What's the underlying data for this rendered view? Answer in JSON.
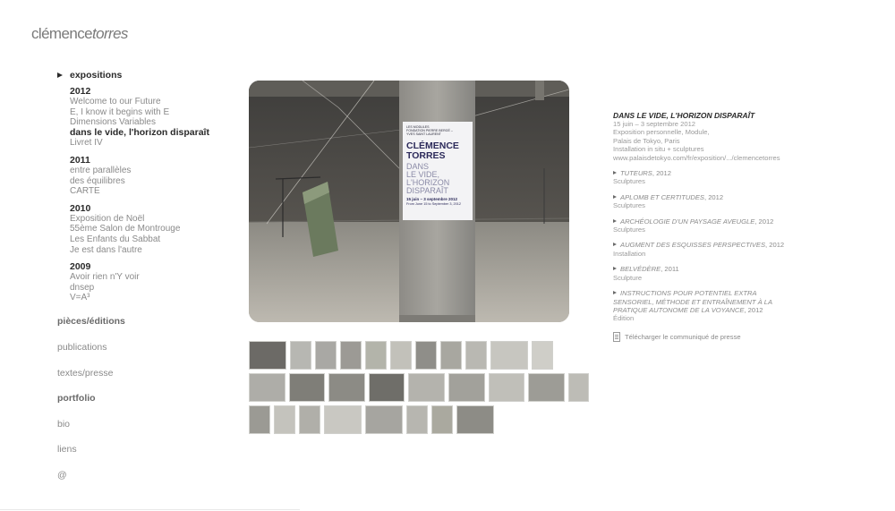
{
  "site": {
    "logo_prefix": "clémence",
    "logo_suffix": "torres"
  },
  "nav": {
    "section": "expositions",
    "years": [
      {
        "year": "2012",
        "items": [
          "Welcome to our Future",
          "E, I know it begins with E",
          "Dimensions Variables",
          "dans le vide, l'horizon disparaît",
          "Livret IV"
        ]
      },
      {
        "year": "2011",
        "items": [
          "entre parallèles",
          "des équilibres",
          "CARTE"
        ]
      },
      {
        "year": "2010",
        "items": [
          "Exposition de Noël",
          "55ème Salon de Montrouge",
          "Les Enfants du Sabbat",
          "Je est dans l'autre"
        ]
      },
      {
        "year": "2009",
        "items": [
          "Avoir rien n'Y voir",
          "dnsep",
          "V=A³"
        ]
      }
    ],
    "active_item": "dans le vide, l'horizon disparaît",
    "menu": [
      {
        "label": "pièces/éditions",
        "bold": true
      },
      {
        "label": "publications",
        "bold": false
      },
      {
        "label": "textes/presse",
        "bold": false
      },
      {
        "label": "portfolio",
        "bold": true
      },
      {
        "label": "bio",
        "bold": false
      },
      {
        "label": "liens",
        "bold": false
      },
      {
        "label": "@",
        "bold": false
      }
    ]
  },
  "poster": {
    "org_line1": "LES MODULES",
    "org_line2": "FONDATION PIERRE BERGÉ –",
    "org_line3": "YVES SAINT LAURENT",
    "name_line1": "CLÉMENCE",
    "name_line2": "TORRES",
    "sub_line1": "DANS",
    "sub_line2": "LE VIDE,",
    "sub_line3": "L'HORIZON",
    "sub_line4": "DISPARAÎT",
    "dates_fr": "15 juin – 3 septembre 2012",
    "dates_en": "From June 15 to September 3, 2012"
  },
  "details": {
    "title": "DANS LE VIDE, L'HORIZON DISPARAÎT",
    "lines": [
      "15 juin – 3 septembre 2012",
      "Exposition personnelle, Module,",
      "Palais de Tokyo, Paris",
      "Installation in situ + sculptures",
      "www.palaisdetokyo.com/fr/exposition/.../clemencetorres"
    ],
    "works": [
      {
        "title": "TUTEURS",
        "year": ", 2012",
        "type": "Sculptures"
      },
      {
        "title": "APLOMB ET CERTITUDES",
        "year": ", 2012",
        "type": "Sculptures"
      },
      {
        "title": "ARCHÉOLOGIE D'UN PAYSAGE AVEUGLE",
        "year": ", 2012",
        "type": "Sculptures"
      },
      {
        "title": "AUGMENT DES ESQUISSES PERSPECTIVES",
        "year": ", 2012",
        "type": "Installation"
      },
      {
        "title": "BELVÉDÈRE",
        "year": ", 2011",
        "type": "Sculpture"
      },
      {
        "title": "INSTRUCTIONS POUR POTENTIEL EXTRA SENSORIEL, MÉTHODE ET ENTRAÎNEMENT À LA PRATIQUE AUTONOME DE LA VOYANCE",
        "year": ", 2012",
        "type": "Édition"
      }
    ],
    "download_label": "Télécharger le communiqué de presse",
    "download_icon": "document-icon"
  }
}
